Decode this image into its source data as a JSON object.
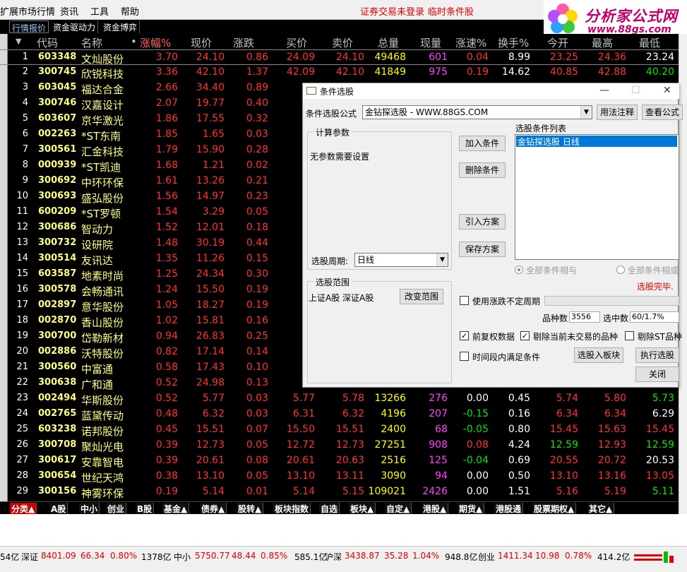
{
  "menu": {
    "items": [
      "扩展市场行情",
      "资讯",
      "工具",
      "帮助"
    ],
    "warning1": "证券交易未登录",
    "warning2": "临时条件股"
  },
  "logo": {
    "line1": "分析家公式网",
    "line2": "www.88gs.com"
  },
  "tabs": [
    "行情报价",
    "资金驱动力",
    "资金博弈"
  ],
  "table": {
    "headers": [
      "代码",
      "名称",
      "•",
      "涨幅%",
      "现价",
      "涨跌",
      "买价",
      "卖价",
      "总量",
      "现量",
      "涨速%",
      "换手%",
      "今开",
      "最高",
      "最低"
    ],
    "rows": [
      {
        "n": "1",
        "code": "603348",
        "name": "文灿股份",
        "chg_pct": "3.70",
        "price": "24.10",
        "chg": "0.86",
        "bid": "24.09",
        "ask": "24.10",
        "vol": "49468",
        "cur": "601",
        "spd": "0.04",
        "turn": "8.99",
        "open": "23.25",
        "high": "24.36",
        "low": "23.24"
      },
      {
        "n": "2",
        "code": "300745",
        "name": "欣锐科技",
        "chg_pct": "3.36",
        "price": "42.10",
        "chg": "1.37",
        "bid": "42.09",
        "ask": "42.10",
        "vol": "41849",
        "cur": "975",
        "spd": "0.19",
        "turn": "14.62",
        "open": "40.85",
        "high": "42.88",
        "low": "40.20"
      },
      {
        "n": "3",
        "code": "603045",
        "name": "福达合金",
        "chg_pct": "2.66",
        "price": "34.40",
        "chg": "0.89",
        "bid": "34"
      },
      {
        "n": "4",
        "code": "300746",
        "name": "汉嘉设计",
        "chg_pct": "2.07",
        "price": "19.77",
        "chg": "0.40",
        "bid": "19"
      },
      {
        "n": "5",
        "code": "603607",
        "name": "京华激光",
        "chg_pct": "1.86",
        "price": "17.55",
        "chg": "0.32",
        "bid": "17"
      },
      {
        "n": "6",
        "code": "002263",
        "name": "*ST东南",
        "chg_pct": "1.85",
        "price": "1.65",
        "chg": "0.03",
        "bid": "1"
      },
      {
        "n": "7",
        "code": "300561",
        "name": "汇金科技",
        "chg_pct": "1.79",
        "price": "15.90",
        "chg": "0.28",
        "bid": "15"
      },
      {
        "n": "8",
        "code": "000939",
        "name": "*ST凯迪",
        "chg_pct": "1.68",
        "price": "1.21",
        "chg": "0.02",
        "bid": "1"
      },
      {
        "n": "9",
        "code": "300692",
        "name": "中环环保",
        "chg_pct": "1.61",
        "price": "13.26",
        "chg": "0.21",
        "bid": "13"
      },
      {
        "n": "10",
        "code": "300693",
        "name": "盛弘股份",
        "chg_pct": "1.56",
        "price": "14.97",
        "chg": "0.23",
        "bid": "14"
      },
      {
        "n": "11",
        "code": "600209",
        "name": "*ST罗顿",
        "chg_pct": "1.54",
        "price": "3.29",
        "chg": "0.05",
        "bid": "3"
      },
      {
        "n": "12",
        "code": "300686",
        "name": "智动力",
        "chg_pct": "1.52",
        "price": "12.01",
        "chg": "0.18",
        "bid": "12"
      },
      {
        "n": "13",
        "code": "300732",
        "name": "设研院",
        "chg_pct": "1.48",
        "price": "30.19",
        "chg": "0.44",
        "bid": "30"
      },
      {
        "n": "14",
        "code": "300514",
        "name": "友讯达",
        "chg_pct": "1.35",
        "price": "11.26",
        "chg": "0.15",
        "bid": "11"
      },
      {
        "n": "15",
        "code": "603587",
        "name": "地素时尚",
        "chg_pct": "1.25",
        "price": "24.34",
        "chg": "0.30",
        "bid": "24"
      },
      {
        "n": "16",
        "code": "300578",
        "name": "会畅通讯",
        "chg_pct": "1.24",
        "price": "15.50",
        "chg": "0.19",
        "bid": "15"
      },
      {
        "n": "17",
        "code": "002897",
        "name": "意华股份",
        "chg_pct": "1.05",
        "price": "18.27",
        "chg": "0.19",
        "bid": "18"
      },
      {
        "n": "18",
        "code": "002870",
        "name": "香山股份",
        "chg_pct": "1.02",
        "price": "15.81",
        "chg": "0.16",
        "bid": "15"
      },
      {
        "n": "19",
        "code": "300700",
        "name": "岱勒新材",
        "chg_pct": "0.94",
        "price": "26.83",
        "chg": "0.25",
        "bid": "26"
      },
      {
        "n": "20",
        "code": "002886",
        "name": "沃特股份",
        "chg_pct": "0.82",
        "price": "17.14",
        "chg": "0.14",
        "bid": "17"
      },
      {
        "n": "21",
        "code": "300560",
        "name": "中富通",
        "chg_pct": "0.58",
        "price": "17.43",
        "chg": "0.10",
        "bid": "17"
      },
      {
        "n": "22",
        "code": "300638",
        "name": "广和通",
        "chg_pct": "0.52",
        "price": "24.98",
        "chg": "0.13",
        "bid": "24"
      },
      {
        "n": "23",
        "code": "002494",
        "name": "华斯股份",
        "chg_pct": "0.52",
        "price": "5.77",
        "chg": "0.03",
        "bid": "5.77",
        "ask": "5.78",
        "vol": "13266",
        "cur": "276",
        "spd": "0.00",
        "turn": "0.45",
        "open": "5.74",
        "high": "5.80",
        "low": "5.73"
      },
      {
        "n": "24",
        "code": "002765",
        "name": "蓝黛传动",
        "chg_pct": "0.48",
        "price": "6.32",
        "chg": "0.03",
        "bid": "6.31",
        "ask": "6.32",
        "vol": "4196",
        "cur": "207",
        "spd": "-0.15",
        "turn": "0.16",
        "open": "6.34",
        "high": "6.34",
        "low": "6.29"
      },
      {
        "n": "25",
        "code": "603238",
        "name": "诺邦股份",
        "chg_pct": "0.45",
        "price": "15.51",
        "chg": "0.07",
        "bid": "15.50",
        "ask": "15.51",
        "vol": "2400",
        "cur": "68",
        "spd": "-0.05",
        "turn": "0.80",
        "open": "15.45",
        "high": "15.63",
        "low": "15.45"
      },
      {
        "n": "26",
        "code": "300708",
        "name": "聚灿光电",
        "chg_pct": "0.39",
        "price": "12.73",
        "chg": "0.05",
        "bid": "12.72",
        "ask": "12.73",
        "vol": "27251",
        "cur": "908",
        "spd": "0.08",
        "turn": "4.24",
        "open": "12.59",
        "high": "12.93",
        "low": "12.59"
      },
      {
        "n": "27",
        "code": "300617",
        "name": "安靠智电",
        "chg_pct": "0.39",
        "price": "20.61",
        "chg": "0.08",
        "bid": "20.61",
        "ask": "20.63",
        "vol": "2516",
        "cur": "125",
        "spd": "-0.04",
        "turn": "0.69",
        "open": "20.55",
        "high": "20.72",
        "low": "20.53"
      },
      {
        "n": "28",
        "code": "300654",
        "name": "世纪天鸿",
        "chg_pct": "0.38",
        "price": "13.10",
        "chg": "0.05",
        "bid": "13.10",
        "ask": "13.11",
        "vol": "3090",
        "cur": "94",
        "spd": "0.00",
        "turn": "0.50",
        "open": "13.10",
        "high": "13.16",
        "low": "13.05"
      },
      {
        "n": "29",
        "code": "300156",
        "name": "神雾环保",
        "chg_pct": "0.19",
        "price": "5.14",
        "chg": "0.01",
        "bid": "5.14",
        "ask": "5.15",
        "vol": "109021",
        "cur": "2426",
        "spd": "0.00",
        "turn": "1.51",
        "open": "5.16",
        "high": "5.19",
        "low": "5.11"
      }
    ]
  },
  "bottom_tabs": [
    "分类▲",
    "A股",
    "中小",
    "创业",
    "B股",
    "基金▲",
    "债券▲",
    "股转▲",
    "板块指数",
    "自选",
    "板块▲",
    "自定▲",
    "港股▲",
    "期货▲",
    "港股通",
    "股票期权▲",
    "其它▲"
  ],
  "statusbar": [
    {
      "t": "54亿",
      "c": "d"
    },
    {
      "t": "深证",
      "c": "d"
    },
    {
      "t": "8401.09",
      "c": "r"
    },
    {
      "t": "66.34",
      "c": "r"
    },
    {
      "t": "0.80%",
      "c": "r"
    },
    {
      "t": "1378亿",
      "c": "d"
    },
    {
      "t": "中小",
      "c": "d"
    },
    {
      "t": "5750.77",
      "c": "r"
    },
    {
      "t": "48.44",
      "c": "r"
    },
    {
      "t": "0.85%",
      "c": "r"
    },
    {
      "t": "585.1亿",
      "c": "d"
    },
    {
      "t": "沪深",
      "c": "d"
    },
    {
      "t": "3438.87",
      "c": "r"
    },
    {
      "t": "35.28",
      "c": "r"
    },
    {
      "t": "1.04%",
      "c": "r"
    },
    {
      "t": "948.8亿",
      "c": "d"
    },
    {
      "t": "创业",
      "c": "d"
    },
    {
      "t": "1411.34",
      "c": "r"
    },
    {
      "t": "10.98",
      "c": "r"
    },
    {
      "t": "0.78%",
      "c": "r"
    },
    {
      "t": "414.2亿",
      "c": "d"
    }
  ],
  "dialog": {
    "title": "条件选股",
    "formula_label": "条件选股公式",
    "formula_value": "金钻探选股   - WWW.88GS.COM",
    "usage_btn": "用法注释",
    "view_btn": "查看公式",
    "params_group": "计算参数",
    "params_text": "无参数需要设置",
    "period_label": "选股周期:",
    "period_value": "日线",
    "add_btn": "加入条件",
    "del_btn": "删除条件",
    "import_btn": "引入方案",
    "save_btn": "保存方案",
    "list_label": "选股条件列表",
    "list_item": "金钻探选股  日线",
    "radio_and": "全部条件相与",
    "radio_or": "全部条件相或",
    "done_text": "选股完毕.",
    "range_group": "选股范围",
    "range_text": "上证A股 深证A股",
    "change_range_btn": "改变范围",
    "use_uncertain": "使用涨跌不定周期",
    "count_label": "品种数",
    "count_value": "3556",
    "selected_label": "选中数",
    "selected_value": "60/1.7%",
    "pre_rights": "前复权数据",
    "exclude_untraded": "剔除当前未交易的品种",
    "exclude_st": "剔除ST品种",
    "time_range": "时间段内满足条件",
    "to_block_btn": "选股入板块",
    "run_btn": "执行选股",
    "close_btn": "关闭"
  }
}
